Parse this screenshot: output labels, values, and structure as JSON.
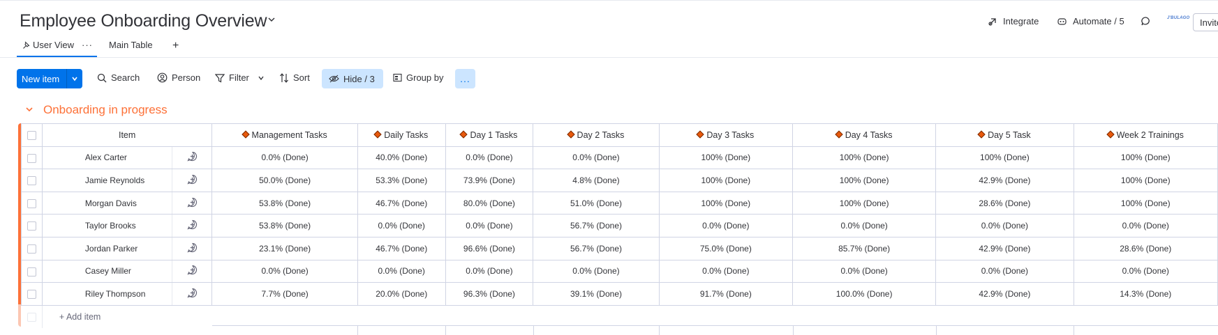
{
  "board": {
    "title": "Employee Onboarding Overview"
  },
  "header": {
    "integrate_label": "Integrate",
    "automate_label": "Automate / 5",
    "logo_text": "J'BULAGO",
    "invite_label": "Invite"
  },
  "tabs": [
    {
      "label": "User View"
    },
    {
      "label": "Main Table"
    }
  ],
  "toolbar": {
    "new_item_label": "New item",
    "search_label": "Search",
    "person_label": "Person",
    "filter_label": "Filter",
    "sort_label": "Sort",
    "hide_label": "Hide / 3",
    "group_by_label": "Group by",
    "more_label": "..."
  },
  "group": {
    "title": "Onboarding in progress",
    "color": "#fd7138"
  },
  "table": {
    "item_header": "Item",
    "columns": [
      "Management Tasks",
      "Daily Tasks",
      "Day 1 Tasks",
      "Day 2 Tasks",
      "Day 3 Tasks",
      "Day 4 Tasks",
      "Day 5 Task",
      "Week 2 Trainings"
    ],
    "rows": [
      {
        "name": "Alex Carter",
        "values": [
          "0.0% (Done)",
          "40.0% (Done)",
          "0.0% (Done)",
          "0.0% (Done)",
          "100% (Done)",
          "100% (Done)",
          "100% (Done)",
          "100% (Done)"
        ]
      },
      {
        "name": "Jamie Reynolds",
        "values": [
          "50.0% (Done)",
          "53.3% (Done)",
          "73.9% (Done)",
          "4.8% (Done)",
          "100% (Done)",
          "100% (Done)",
          "42.9% (Done)",
          "100% (Done)"
        ]
      },
      {
        "name": "Morgan Davis",
        "values": [
          "53.8% (Done)",
          "46.7% (Done)",
          "80.0% (Done)",
          "51.0% (Done)",
          "100% (Done)",
          "100% (Done)",
          "28.6% (Done)",
          "100% (Done)"
        ]
      },
      {
        "name": "Taylor Brooks",
        "values": [
          "53.8% (Done)",
          "0.0% (Done)",
          "0.0% (Done)",
          "56.7% (Done)",
          "0.0% (Done)",
          "0.0% (Done)",
          "0.0% (Done)",
          "0.0% (Done)"
        ]
      },
      {
        "name": "Jordan Parker",
        "values": [
          "23.1% (Done)",
          "46.7% (Done)",
          "96.6% (Done)",
          "56.7% (Done)",
          "75.0% (Done)",
          "85.7% (Done)",
          "42.9% (Done)",
          "28.6% (Done)"
        ]
      },
      {
        "name": "Casey Miller",
        "values": [
          "0.0% (Done)",
          "0.0% (Done)",
          "0.0% (Done)",
          "0.0% (Done)",
          "0.0% (Done)",
          "0.0% (Done)",
          "0.0% (Done)",
          "0.0% (Done)"
        ]
      },
      {
        "name": "Riley Thompson",
        "values": [
          "7.7% (Done)",
          "20.0% (Done)",
          "96.3% (Done)",
          "39.1% (Done)",
          "91.7% (Done)",
          "100.0% (Done)",
          "42.9% (Done)",
          "14.3% (Done)"
        ]
      }
    ],
    "add_item_label": "+ Add item"
  }
}
